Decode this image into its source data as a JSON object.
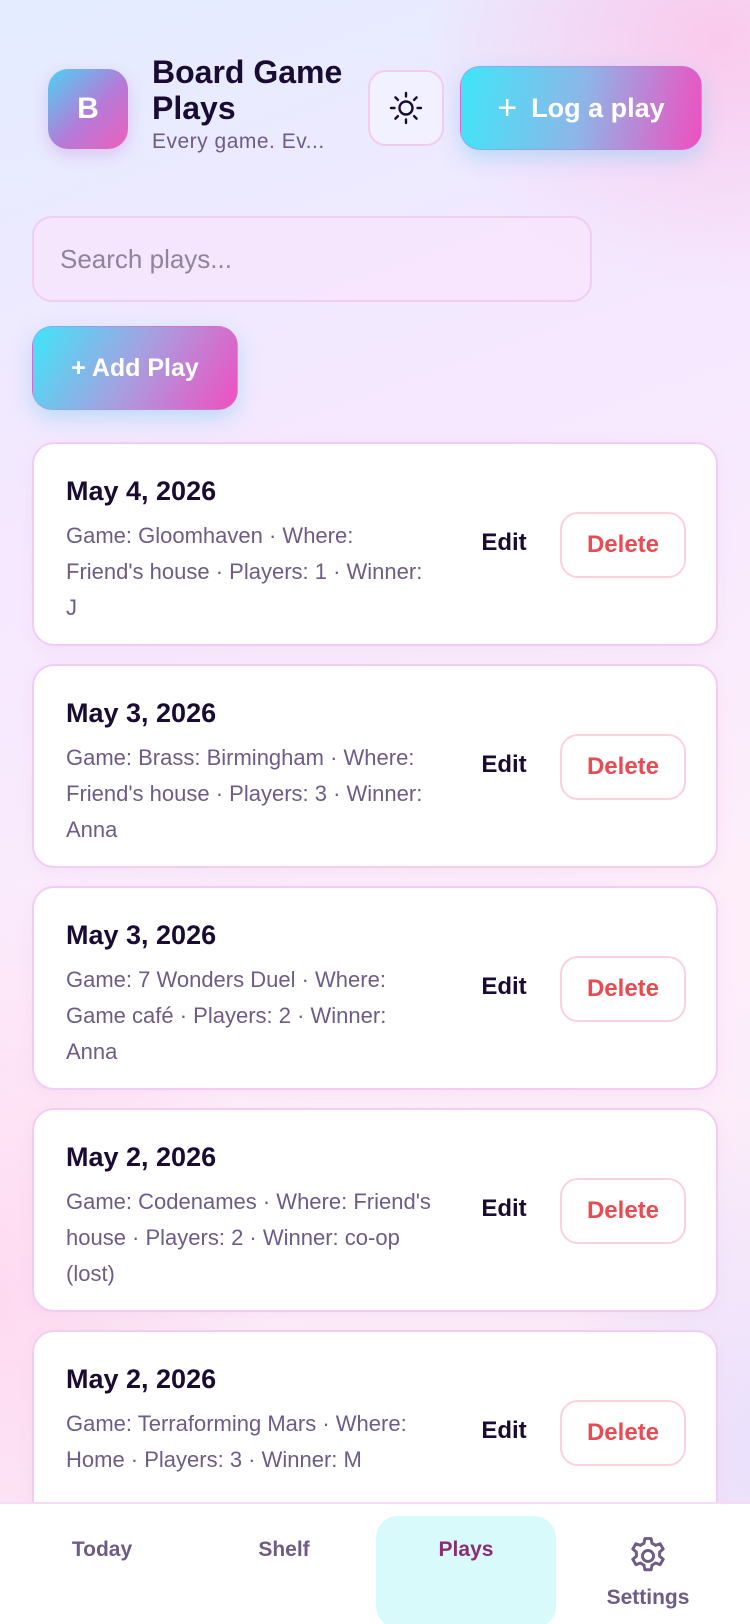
{
  "header": {
    "logo_letter": "B",
    "title": "Board Game Plays",
    "subtitle": "Every game. Ev...",
    "theme_icon": "sun-icon",
    "log_button_label": "Log a play"
  },
  "search": {
    "placeholder": "Search plays...",
    "value": ""
  },
  "add_button_label": "+ Add Play",
  "plays": [
    {
      "date": "May 4, 2026",
      "details": "Game: Gloomhaven · Where: Friend's house · Players: 1 · Winner: J",
      "edit": "Edit",
      "delete": "Delete"
    },
    {
      "date": "May 3, 2026",
      "details": "Game: Brass: Birmingham · Where: Friend's house · Players: 3 · Winner: Anna",
      "edit": "Edit",
      "delete": "Delete"
    },
    {
      "date": "May 3, 2026",
      "details": "Game: 7 Wonders Duel · Where: Game café · Players: 2 · Winner: Anna",
      "edit": "Edit",
      "delete": "Delete"
    },
    {
      "date": "May 2, 2026",
      "details": "Game: Codenames · Where: Friend's house · Players: 2 · Winner: co-op (lost)",
      "edit": "Edit",
      "delete": "Delete"
    },
    {
      "date": "May 2, 2026",
      "details": "Game: Terraforming Mars · Where: Home · Players: 3 · Winner: M",
      "edit": "Edit",
      "delete": "Delete"
    }
  ],
  "nav": {
    "today": "Today",
    "shelf": "Shelf",
    "plays": "Plays",
    "settings": "Settings",
    "settings_icon": "gear-icon",
    "active": "Plays"
  },
  "colors": {
    "accent_cyan": "#3ee6f8",
    "accent_pink": "#ef4fbf",
    "delete_red": "#ea4b52",
    "active_tab_bg": "#d8fafb"
  }
}
